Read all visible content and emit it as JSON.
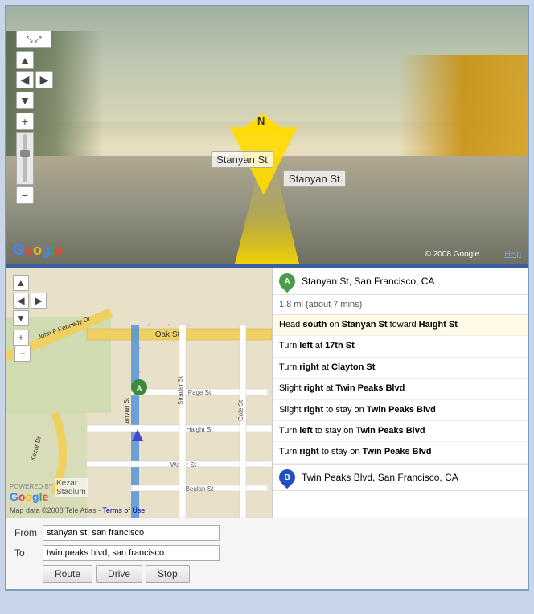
{
  "streetview": {
    "street_label_top": "Stanyan St",
    "street_label_bottom": "Stanyan St",
    "compass": "N",
    "copyright": "© 2008 Google",
    "help_label": "Help"
  },
  "map": {
    "powered_by": "POWERED BY",
    "google_label": "Google",
    "copyright": "Map data ©2008 Tele Atlas -",
    "terms_link": "Terms of Use",
    "kezar_label": "Kezar\nStadium"
  },
  "directions": {
    "origin_label": "Stanyan St, San Francisco, CA",
    "destination_label": "Twin Peaks Blvd, San Francisco, CA",
    "summary": "1.8 mi (about 7 mins)",
    "steps": [
      {
        "text": "Head south on Stanyan St toward Haight St",
        "highlight": true
      },
      {
        "text": "Turn left at 17th St",
        "highlight": false
      },
      {
        "text": "Turn right at Clayton St",
        "highlight": false
      },
      {
        "text": "Slight right at Twin Peaks Blvd",
        "highlight": false
      },
      {
        "text": "Slight right to stay on Twin Peaks Blvd",
        "highlight": false
      },
      {
        "text": "Turn left to stay on Twin Peaks Blvd",
        "highlight": false
      },
      {
        "text": "Turn right to stay on Twin Peaks Blvd",
        "highlight": false
      }
    ]
  },
  "form": {
    "from_label": "From",
    "to_label": "To",
    "from_value": "stanyan st, san francisco",
    "to_value": "twin peaks blvd, san francisco",
    "route_btn": "Route",
    "drive_btn": "Drive",
    "stop_btn": "Stop"
  }
}
